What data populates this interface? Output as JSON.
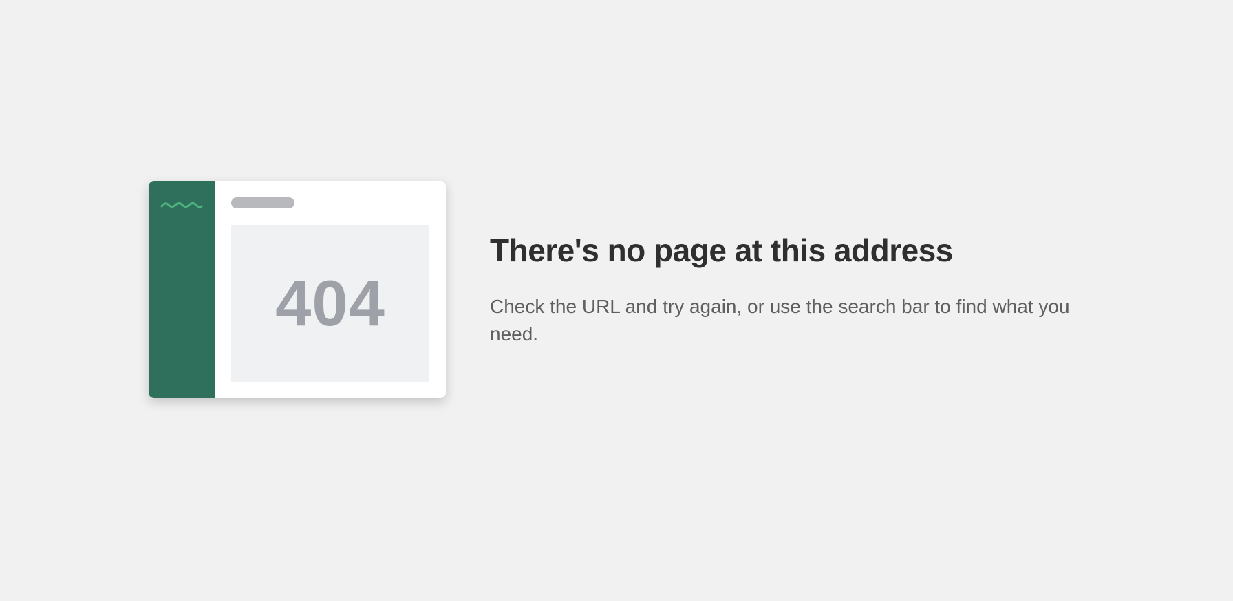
{
  "illustration": {
    "code": "404",
    "sidebar_color": "#2e705b",
    "logo_color": "#4fb37f",
    "logo_icon": "wave-logo-icon"
  },
  "message": {
    "heading": "There's no page at this address",
    "description": "Check the URL and try again, or use the search bar to find what you need."
  }
}
